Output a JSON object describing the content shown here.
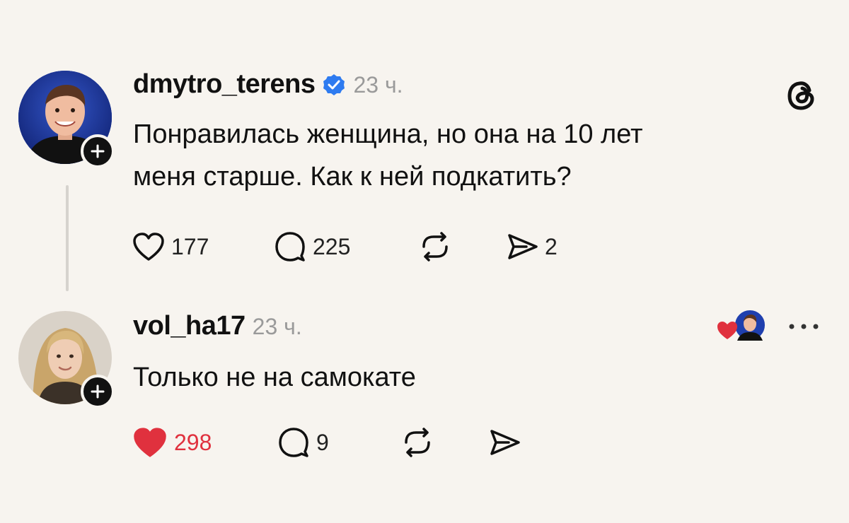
{
  "post": {
    "username": "dmytro_terens",
    "verified": true,
    "time": "23 ч.",
    "text_line1": "Понравилась женщина, но она на 10 лет",
    "text_line2": "меня старше. Как к ней подкатить?",
    "likes": "177",
    "comments": "225",
    "shares": "2",
    "liked": false
  },
  "reply": {
    "username": "vol_ha17",
    "time": "23 ч.",
    "text": "Только не на самокате",
    "likes": "298",
    "comments": "9",
    "liked": true,
    "liked_by_author": true
  },
  "icons": {
    "app": "threads-logo-icon",
    "like": "heart-icon",
    "comment": "comment-bubble-icon",
    "repost": "repost-icon",
    "share": "send-icon",
    "more": "more-dots-icon"
  },
  "colors": {
    "background": "#f7f4ef",
    "verified": "#2e7bf0",
    "liked": "#e0313e",
    "muted": "#9a9a9a"
  }
}
